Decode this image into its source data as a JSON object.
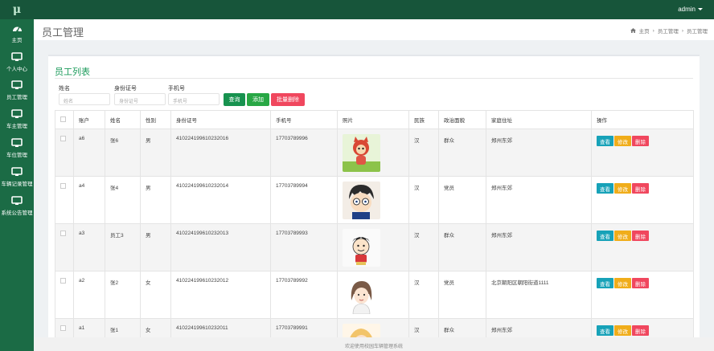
{
  "logo": "μ",
  "header": {
    "user": "admin"
  },
  "sidebar": {
    "items": [
      {
        "label": "主页",
        "icon": "dashboard-icon"
      },
      {
        "label": "个人中心",
        "icon": "monitor-icon"
      },
      {
        "label": "员工管理",
        "icon": "monitor-icon"
      },
      {
        "label": "车主管理",
        "icon": "monitor-icon"
      },
      {
        "label": "车位管理",
        "icon": "monitor-icon"
      },
      {
        "label": "车辆记录管理",
        "icon": "monitor-icon"
      },
      {
        "label": "系统公告管理",
        "icon": "monitor-icon"
      }
    ]
  },
  "page": {
    "title": "员工管理"
  },
  "breadcrumb": [
    "主页",
    "员工管理",
    "员工管理"
  ],
  "card": {
    "title": "员工列表"
  },
  "search": {
    "name_label": "姓名",
    "name_placeholder": "姓名",
    "id_label": "身份证号",
    "id_placeholder": "身份证号",
    "phone_label": "手机号",
    "phone_placeholder": "手机号"
  },
  "buttons": {
    "query": "查询",
    "add": "添加",
    "batch_delete": "批量删除"
  },
  "table": {
    "headers": [
      "账户",
      "姓名",
      "性别",
      "身份证号",
      "手机号",
      "照片",
      "民族",
      "政治面貌",
      "家庭住址",
      "操作"
    ],
    "rows": [
      {
        "account": "a6",
        "name": "张6",
        "gender": "男",
        "id": "410224199610232016",
        "phone": "17703789996",
        "ethnic": "汉",
        "political": "群众",
        "address": "郑州东郊",
        "photo": "cartoon-cat-photo"
      },
      {
        "account": "a4",
        "name": "张4",
        "gender": "男",
        "id": "410224199610232014",
        "phone": "17703789994",
        "ethnic": "汉",
        "political": "党员",
        "address": "郑州东郊",
        "photo": "cartoon-boy-glasses-photo"
      },
      {
        "account": "a3",
        "name": "员工3",
        "gender": "男",
        "id": "410224199610232013",
        "phone": "17703789993",
        "ethnic": "汉",
        "political": "群众",
        "address": "郑州东郊",
        "photo": "cartoon-kid-photo"
      },
      {
        "account": "a2",
        "name": "张2",
        "gender": "女",
        "id": "410224199610232012",
        "phone": "17703789992",
        "ethnic": "汉",
        "political": "党员",
        "address": "北京朝阳区朝阳街道1111",
        "photo": "cartoon-girl-photo"
      },
      {
        "account": "a1",
        "name": "张1",
        "gender": "女",
        "id": "410224199610232011",
        "phone": "17703789991",
        "ethnic": "汉",
        "political": "群众",
        "address": "郑州东郊",
        "photo": "cartoon-blonde-photo"
      }
    ],
    "actions": {
      "view": "查看",
      "edit": "修改",
      "delete": "删除"
    }
  },
  "footer": "欢迎使用校园车辆管理系统",
  "colors": {
    "topbar": "#17553a",
    "sidebar": "#1b6b45",
    "accent": "#1d9b5c",
    "view": "#17a2b8",
    "edit": "#f0ad1a",
    "delete": "#f0475e",
    "query": "#17924f",
    "add": "#28a745"
  }
}
